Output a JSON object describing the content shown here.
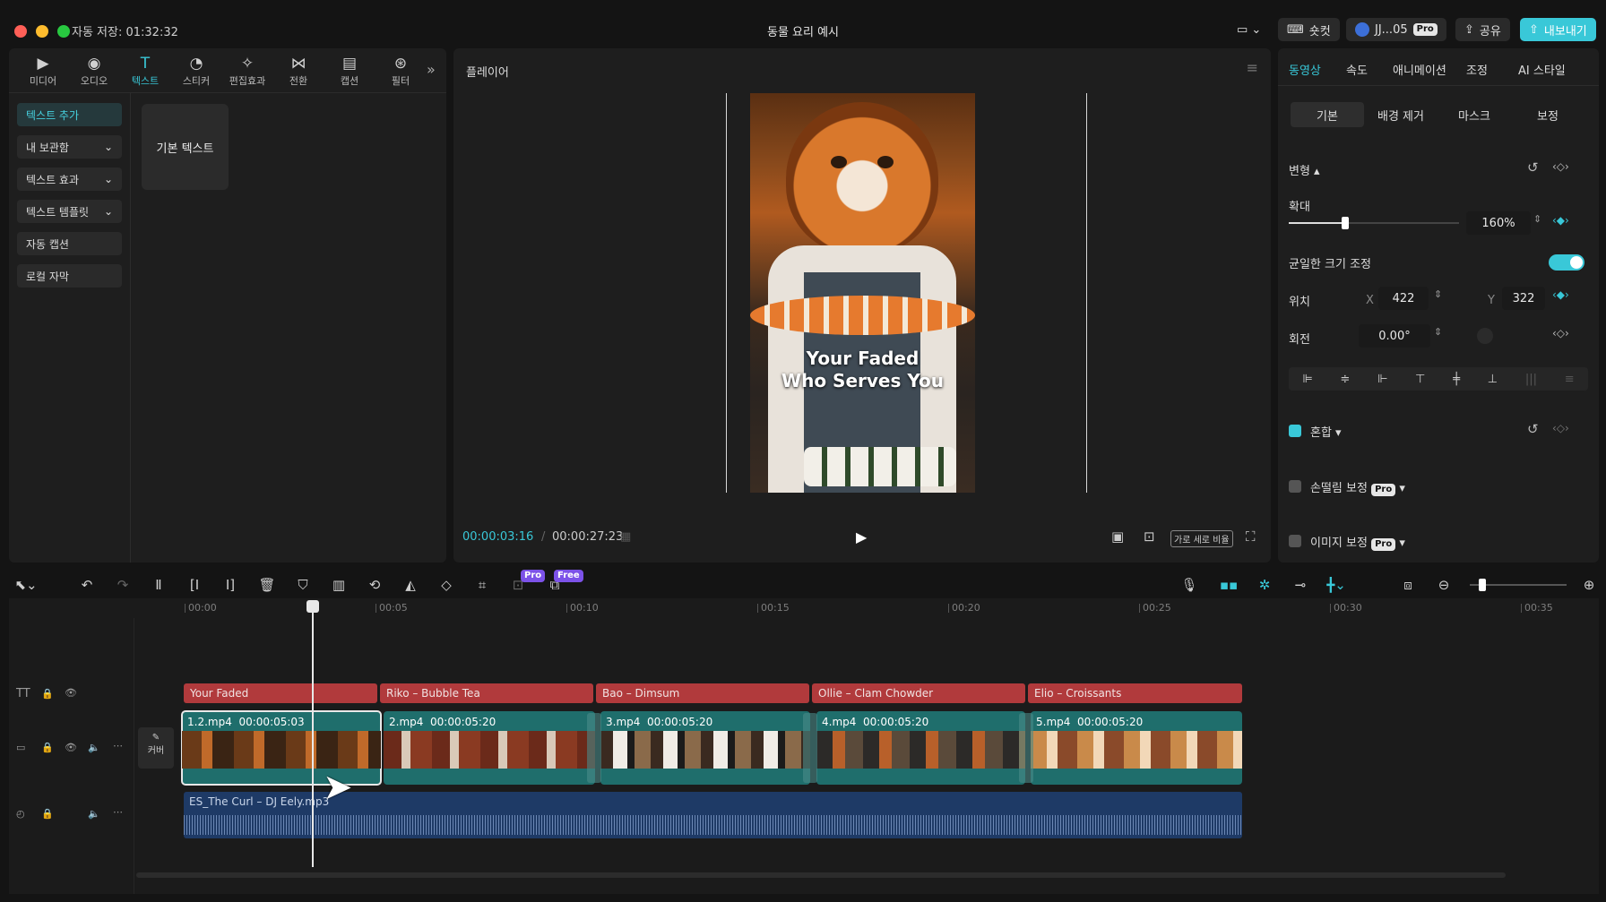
{
  "window": {
    "autosave": "자동 저장: 01:32:32",
    "title": "동물 요리 예시"
  },
  "topbar": {
    "shortcut": "숏컷",
    "account": "JJ...05",
    "pro": "Pro",
    "share": "공유",
    "export": "내보내기"
  },
  "tools": [
    {
      "label": "미디어",
      "icon": "▶"
    },
    {
      "label": "오디오",
      "icon": "◉"
    },
    {
      "label": "텍스트",
      "icon": "T"
    },
    {
      "label": "스티커",
      "icon": "◔"
    },
    {
      "label": "편집효과",
      "icon": "✧"
    },
    {
      "label": "전환",
      "icon": "⋈"
    },
    {
      "label": "캡션",
      "icon": "▤"
    },
    {
      "label": "필터",
      "icon": "⊛"
    }
  ],
  "left_menu": [
    {
      "label": "텍스트 추가",
      "arrow": ""
    },
    {
      "label": "내 보관함",
      "arrow": "⌄"
    },
    {
      "label": "텍스트 효과",
      "arrow": "⌄"
    },
    {
      "label": "텍스트 템플릿",
      "arrow": "⌄"
    },
    {
      "label": "자동 캡션",
      "arrow": ""
    },
    {
      "label": "로컬 자막",
      "arrow": ""
    }
  ],
  "default_text_card": "기본 텍스트",
  "player": {
    "title": "플레이어",
    "caption_line1": "Your Faded",
    "caption_line2": "Who Serves You",
    "current_time": "00:00:03:16",
    "total_time": "00:00:27:23",
    "ratio": "가로 세로 비율"
  },
  "inspector": {
    "tabs": [
      "동영상",
      "속도",
      "애니메이션",
      "조정",
      "AI 스타일"
    ],
    "subtabs": [
      "기본",
      "배경 제거",
      "마스크",
      "보정"
    ],
    "transform": "변형",
    "scale_label": "확대",
    "scale_value": "160%",
    "scale_fraction": 0.33,
    "uniform_label": "균일한 크기 조정",
    "position_label": "위치",
    "x_label": "X",
    "x_value": "422",
    "y_label": "Y",
    "y_value": "322",
    "rotation_label": "회전",
    "rotation_value": "0.00°",
    "blend": "혼합",
    "stabilize": "손떨림 보정",
    "image_enhance": "이미지 보정",
    "pro_badge": "Pro"
  },
  "toolbar": {
    "pro_badge": "Pro",
    "free_badge": "Free"
  },
  "timeline": {
    "ticks": [
      "00:00",
      "00:05",
      "00:10",
      "00:15",
      "00:20",
      "00:25",
      "00:30",
      "00:35"
    ],
    "text_clips": [
      "Your Faded",
      "Riko – Bubble Tea",
      "Bao – Dimsum",
      "Ollie – Clam Chowder",
      "Elio – Croissants"
    ],
    "video_clips": [
      {
        "name": "1.2.mp4",
        "dur": "00:00:05:03"
      },
      {
        "name": "2.mp4",
        "dur": "00:00:05:20"
      },
      {
        "name": "3.mp4",
        "dur": "00:00:05:20"
      },
      {
        "name": "4.mp4",
        "dur": "00:00:05:20"
      },
      {
        "name": "5.mp4",
        "dur": "00:00:05:20"
      }
    ],
    "audio_clip": "ES_The Curl – DJ Eely.mp3",
    "cover": "커버"
  },
  "colors": {
    "accent": "#39c8d8",
    "text_clip": "#b13a3c",
    "video_clip": "#1f6e6c",
    "audio_clip": "#1e3a66"
  }
}
